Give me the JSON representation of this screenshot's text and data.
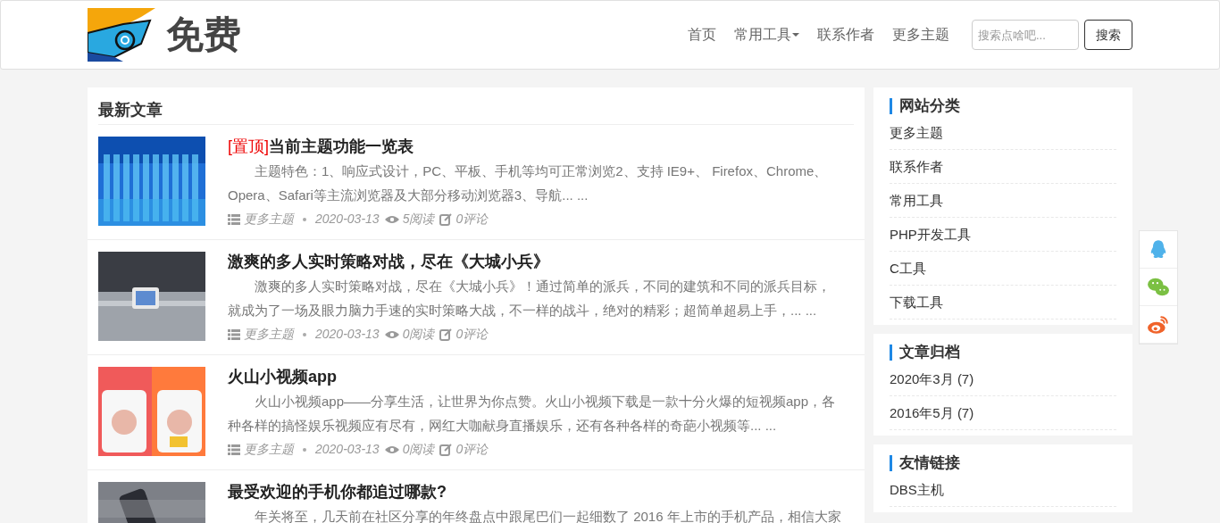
{
  "header": {
    "logo_text": "免费",
    "nav": [
      {
        "label": "首页",
        "dropdown": false
      },
      {
        "label": "常用工具",
        "dropdown": true
      },
      {
        "label": "联系作者",
        "dropdown": false
      },
      {
        "label": "更多主题",
        "dropdown": false
      }
    ],
    "search": {
      "placeholder": "搜索点啥吧...",
      "button": "搜索"
    }
  },
  "main": {
    "heading": "最新文章",
    "articles": [
      {
        "kind": "picture",
        "pinned": "[置顶]",
        "title": "当前主题功能一览表",
        "summary": "主题特色：1、响应式设计，PC、平板、手机等均可正常浏览2、支持 IE9+、 Firefox、Chrome、Opera、Safari等主流浏览器及大部分移动浏览器3、导航... ...",
        "category": "更多主题",
        "date": "2020-03-13",
        "views": "5阅读",
        "comments": "0评论"
      },
      {
        "kind": "picture",
        "title": "激爽的多人实时策略对战，尽在《大城小兵》",
        "summary": "激爽的多人实时策略对战，尽在《大城小兵》！通过简单的派兵，不同的建筑和不同的派兵目标，就成为了一场及眼力脑力手速的实时策略大战，不一样的战斗，绝对的精彩；超简单超易上手，... ...",
        "category": "更多主题",
        "date": "2020-03-13",
        "views": "0阅读",
        "comments": "0评论"
      },
      {
        "kind": "picture",
        "title": "火山小视频app",
        "summary": "火山小视频app——分享生活，让世界为你点赞。火山小视频下载是一款十分火爆的短视频app，各种各样的搞怪娱乐视频应有尽有，网红大咖献身直播娱乐，还有各种各样的奇葩小视频等... ...",
        "category": "更多主题",
        "date": "2020-03-13",
        "views": "0阅读",
        "comments": "0评论"
      },
      {
        "kind": "picture",
        "title": "最受欢迎的手机你都追过哪款?",
        "summary": "年关将至，几天前在社区分享的年终盘点中跟尾巴们一起细数了 2016 年上市的手机产品，相信大家"
      }
    ]
  },
  "sidebar": [
    {
      "title": "网站分类",
      "items": [
        "更多主题",
        "联系作者",
        "常用工具",
        "PHP开发工具",
        "C工具",
        "下载工具"
      ]
    },
    {
      "title": "文章归档",
      "items": [
        "2020年3月 (7)",
        "2016年5月 (7)"
      ]
    },
    {
      "title": "友情链接",
      "items": [
        "DBS主机"
      ]
    }
  ],
  "float_buttons": [
    {
      "kind": "qq"
    },
    {
      "kind": "wechat"
    },
    {
      "kind": "weibo"
    }
  ]
}
